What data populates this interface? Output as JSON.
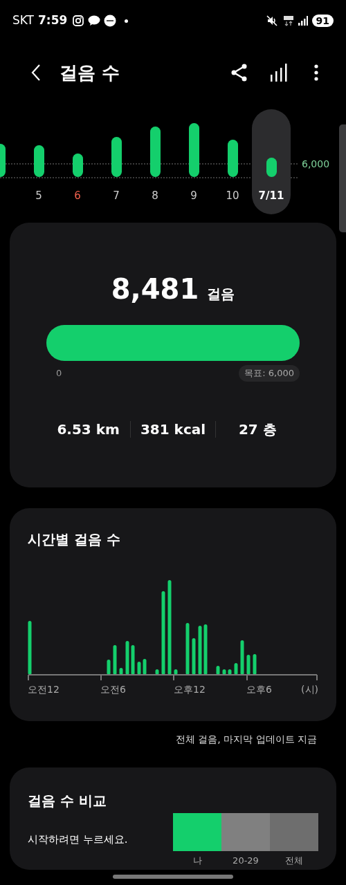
{
  "status_bar": {
    "carrier": "SKT",
    "time": "7:59",
    "battery": "91"
  },
  "header": {
    "title": "걸음 수"
  },
  "week": {
    "goal_label": "6,000",
    "days": [
      {
        "selected": false
      },
      {
        "label": "5",
        "weekend": false,
        "selected": false
      },
      {
        "label": "6",
        "weekend": true,
        "selected": false
      },
      {
        "label": "7",
        "weekend": false,
        "selected": false
      },
      {
        "label": "8",
        "weekend": false,
        "selected": false
      },
      {
        "label": "9",
        "weekend": false,
        "selected": false
      },
      {
        "label": "10",
        "weekend": false,
        "selected": false
      },
      {
        "label": "7/11",
        "weekend": false,
        "selected": true
      }
    ]
  },
  "summary": {
    "steps": "8,481",
    "unit": "걸음",
    "progress": {
      "level": 1,
      "start": "0",
      "goal": "목표: 6,000"
    },
    "stats": [
      "6.53 km",
      "381 kcal",
      "27 층"
    ]
  },
  "hourly": {
    "title": "시간별 걸음 수",
    "axis_labels": [
      "오전12",
      "오전6",
      "오후12",
      "오후6"
    ],
    "axis_unit": "(시)"
  },
  "footnote": "전체 걸음, 마지막 업데이트 지금",
  "compare": {
    "title": "걸음 수 비교",
    "hint": "시작하려면 누르세요.",
    "groups": [
      {
        "label": "나",
        "color": "#14cf6c"
      },
      {
        "label": "20-29",
        "color": "#808080"
      },
      {
        "label": "전체",
        "color": "#6e6e6e"
      }
    ]
  }
}
